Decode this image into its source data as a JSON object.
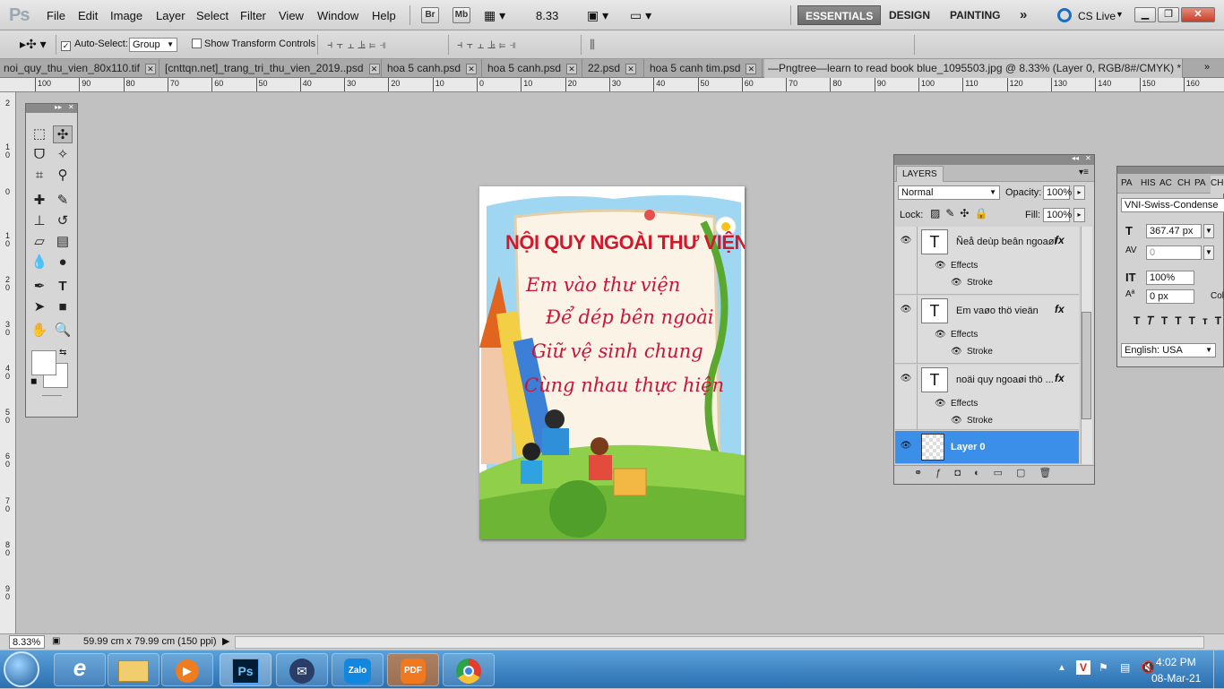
{
  "app": {
    "logo": "Ps"
  },
  "menu": [
    "File",
    "Edit",
    "Image",
    "Layer",
    "Select",
    "Filter",
    "View",
    "Window",
    "Help"
  ],
  "appbar": {
    "br": "Br",
    "mb": "Mb",
    "zoom": "8.33"
  },
  "workspaces": {
    "essentials": "ESSENTIALS",
    "design": "DESIGN",
    "painting": "PAINTING",
    "more": "»",
    "cslive": "CS Live"
  },
  "options": {
    "autoselect": "Auto-Select:",
    "group": "Group",
    "transform": "Show Transform Controls"
  },
  "tabs": [
    "noi_quy_thu_vien_80x110.tif",
    "[cnttqn.net]_trang_tri_thu_vien_2019..psd",
    "hoa 5 canh.psd",
    "hoa 5 canh.psd",
    "22.psd",
    "hoa 5 canh tim.psd",
    "—Pngtree—learn to read book blue_1095503.jpg @ 8.33% (Layer 0, RGB/8#/CMYK) *"
  ],
  "ruler_top": [
    "100",
    "90",
    "80",
    "70",
    "60",
    "50",
    "40",
    "30",
    "20",
    "10",
    "0",
    "10",
    "20",
    "30",
    "40",
    "50",
    "60",
    "70",
    "80",
    "90",
    "100",
    "110",
    "120",
    "130",
    "140",
    "150",
    "160"
  ],
  "ruler_left": [
    "2",
    "1 0",
    "0",
    "1 0",
    "2 0",
    "3 0",
    "4 0",
    "5 0",
    "6 0",
    "7 0",
    "8 0",
    "9 0"
  ],
  "poster": {
    "title": "NỘI QUY NGOÀI THƯ VIỆN",
    "lines": [
      "Em vào thư viện",
      "Để dép bên ngoài",
      "Giữ vệ sinh chung",
      "Cùng nhau thực hiện"
    ]
  },
  "layers_panel": {
    "tab": "LAYERS",
    "blend": "Normal",
    "opacity_label": "Opacity:",
    "opacity": "100%",
    "lock_label": "Lock:",
    "fill_label": "Fill:",
    "fill": "100%",
    "layers": [
      {
        "name": "Ñeå deùp beân ngoaøi",
        "effects": "Effects",
        "stroke": "Stroke"
      },
      {
        "name": "Em vaøo thö vieän",
        "effects": "Effects",
        "stroke": "Stroke"
      },
      {
        "name": "noäi quy ngoaøi thö ...",
        "effects": "Effects",
        "stroke": "Stroke"
      },
      {
        "name": "Layer 0"
      }
    ],
    "fx": "fx"
  },
  "char_panel": {
    "tabs": [
      "PA",
      "HIS",
      "AC",
      "CH",
      "PA",
      "CH"
    ],
    "font": "VNI-Swiss-Condense",
    "size": "367.47 px",
    "tracking": "0",
    "scale": "100%",
    "baseline": "0 px",
    "color_label": "Colo",
    "language": "English: USA"
  },
  "status": {
    "zoom": "8.33%",
    "doc": "59.99 cm x 79.99 cm (150 ppi)"
  },
  "taskbar": {
    "time": "4:02 PM",
    "date": "08-Mar-21",
    "apps": [
      "IE",
      "Explorer",
      "Media",
      "Ps",
      "Mail",
      "Zalo",
      "PDF",
      "Chrome"
    ]
  },
  "colors": {
    "accent": "#3c8fe8",
    "title_red": "#d4172b",
    "ps_blue": "#001d34"
  }
}
